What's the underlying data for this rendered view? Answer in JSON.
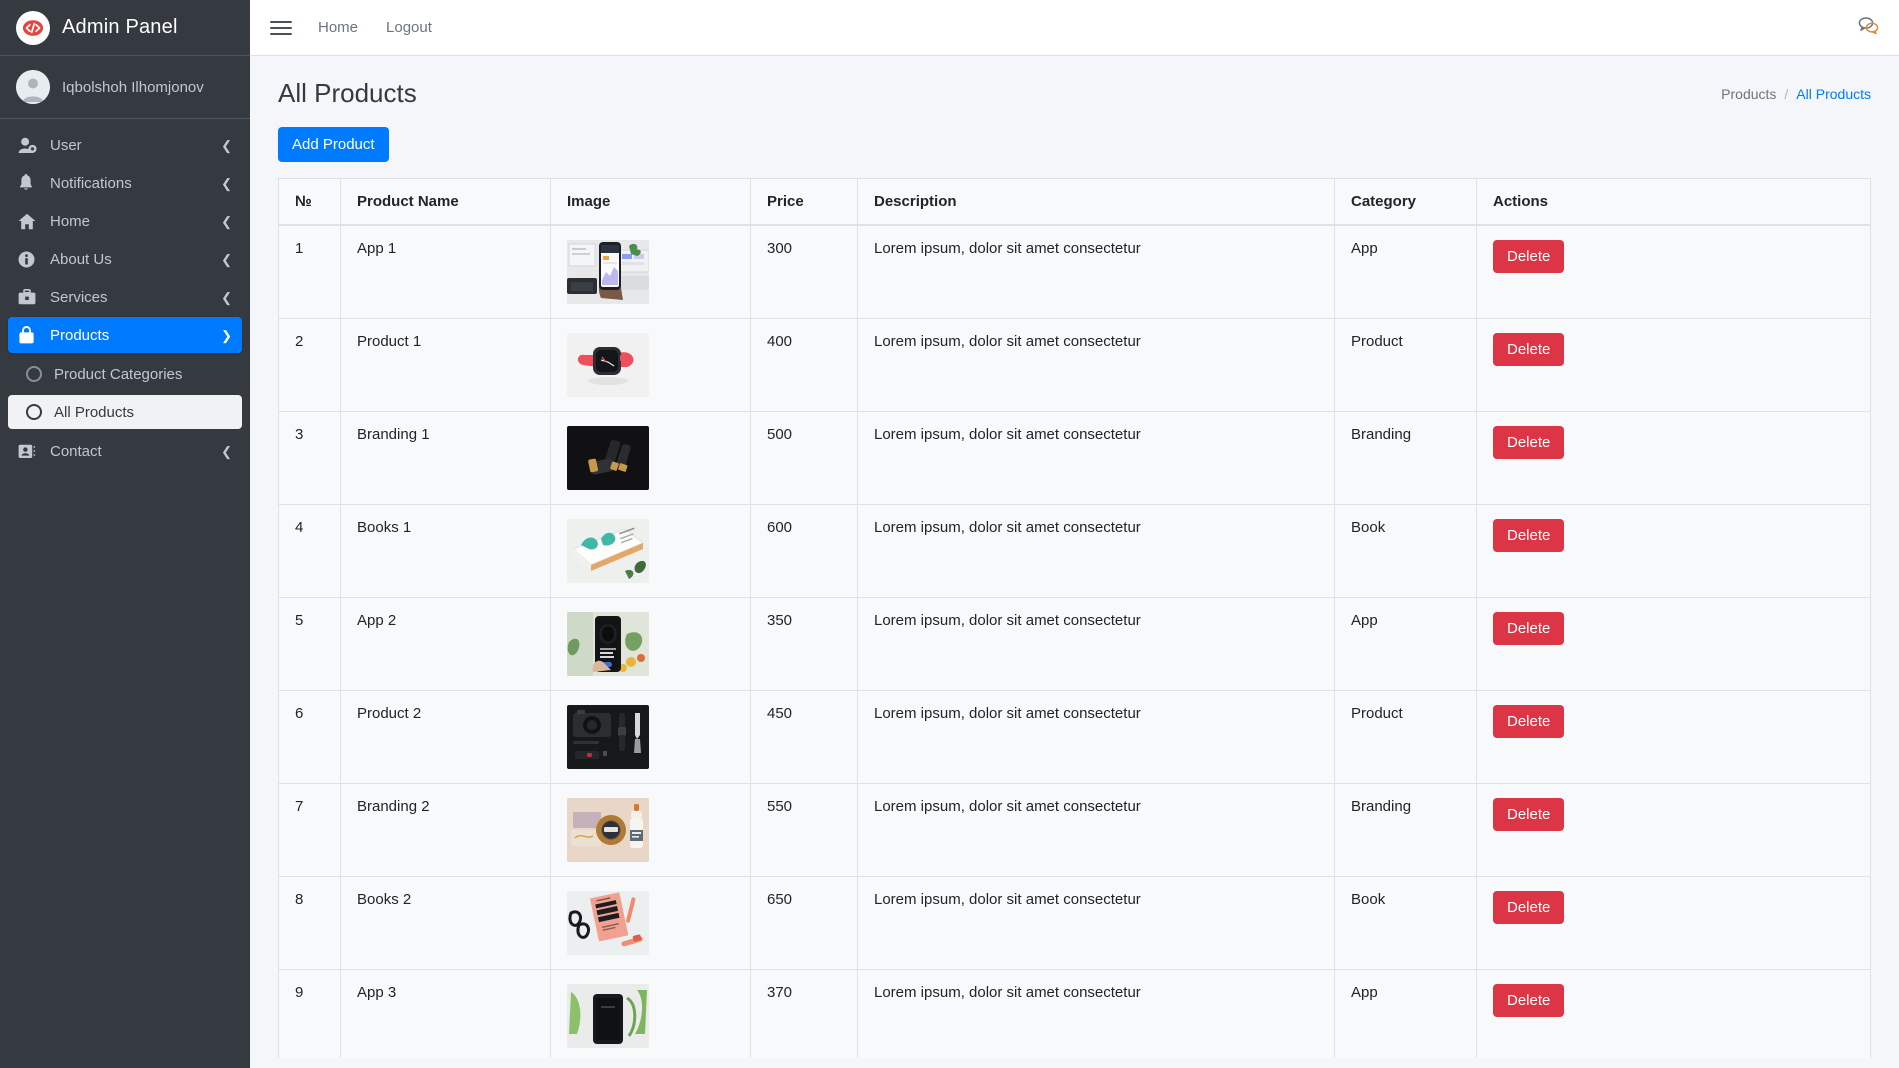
{
  "sidebar": {
    "brand": {
      "title": "Admin Panel",
      "logo_icon": "code-brackets-icon"
    },
    "user": {
      "name": "Iqbolshoh Ilhomjonov",
      "avatar_icon": "user-avatar-icon"
    },
    "items": [
      {
        "label": "User",
        "icon": "user-gear-icon",
        "chevron": "chevron-left-icon",
        "active": false
      },
      {
        "label": "Notifications",
        "icon": "bell-icon",
        "chevron": "chevron-left-icon",
        "active": false
      },
      {
        "label": "Home",
        "icon": "home-icon",
        "chevron": "chevron-left-icon",
        "active": false
      },
      {
        "label": "About Us",
        "icon": "info-circle-icon",
        "chevron": "chevron-left-icon",
        "active": false
      },
      {
        "label": "Services",
        "icon": "briefcase-icon",
        "chevron": "chevron-left-icon",
        "active": false
      },
      {
        "label": "Products",
        "icon": "shopping-bag-icon",
        "chevron": "chevron-down-icon",
        "active": true
      },
      {
        "label": "Contact",
        "icon": "address-card-icon",
        "chevron": "chevron-left-icon",
        "active": false
      }
    ],
    "subitems": [
      {
        "label": "Product Categories",
        "icon": "circle-icon",
        "selected": false
      },
      {
        "label": "All Products",
        "icon": "circle-icon",
        "selected": true
      }
    ]
  },
  "topnav": {
    "menu_icon": "hamburger-icon",
    "links": [
      "Home",
      "Logout"
    ],
    "chat_icon": "comments-icon"
  },
  "header": {
    "title": "All Products",
    "breadcrumb": {
      "parent": "Products",
      "separator": "/",
      "current": "All Products"
    }
  },
  "toolbar": {
    "add_label": "Add Product"
  },
  "table": {
    "columns": [
      "№",
      "Product Name",
      "Image",
      "Price",
      "Description",
      "Category",
      "Actions"
    ],
    "rows": [
      {
        "no": "1",
        "name": "App 1",
        "image": "phone-analytics-photo",
        "price": "300",
        "description": "Lorem ipsum, dolor sit amet consectetur",
        "category": "App",
        "action": "Delete"
      },
      {
        "no": "2",
        "name": "Product 1",
        "image": "red-smartwatch-photo",
        "price": "400",
        "description": "Lorem ipsum, dolor sit amet consectetur",
        "category": "Product",
        "action": "Delete"
      },
      {
        "no": "3",
        "name": "Branding 1",
        "image": "black-gold-cosmetics-photo",
        "price": "500",
        "description": "Lorem ipsum, dolor sit amet consectetur",
        "category": "Branding",
        "action": "Delete"
      },
      {
        "no": "4",
        "name": "Books 1",
        "image": "teal-book-photo",
        "price": "600",
        "description": "Lorem ipsum, dolor sit amet consectetur",
        "category": "Book",
        "action": "Delete"
      },
      {
        "no": "5",
        "name": "App 2",
        "image": "phone-speaker-plants-photo",
        "price": "350",
        "description": "Lorem ipsum, dolor sit amet consectetur",
        "category": "App",
        "action": "Delete"
      },
      {
        "no": "6",
        "name": "Product 2",
        "image": "camera-flatlay-photo",
        "price": "450",
        "description": "Lorem ipsum, dolor sit amet consectetur",
        "category": "Product",
        "action": "Delete"
      },
      {
        "no": "7",
        "name": "Branding 2",
        "image": "cosmetics-branding-photo",
        "price": "550",
        "description": "Lorem ipsum, dolor sit amet consectetur",
        "category": "Branding",
        "action": "Delete"
      },
      {
        "no": "8",
        "name": "Books 2",
        "image": "little-black-book-photo",
        "price": "650",
        "description": "Lorem ipsum, dolor sit amet consectetur",
        "category": "Book",
        "action": "Delete"
      },
      {
        "no": "9",
        "name": "App 3",
        "image": "phone-plants-photo",
        "price": "370",
        "description": "Lorem ipsum, dolor sit amet consectetur",
        "category": "App",
        "action": "Delete"
      }
    ]
  },
  "colors": {
    "sidebar_bg": "#343a40",
    "accent_blue": "#007bff",
    "danger_red": "#dc3545",
    "content_bg": "#f4f6f9",
    "table_bg": "#f8f9fa"
  }
}
